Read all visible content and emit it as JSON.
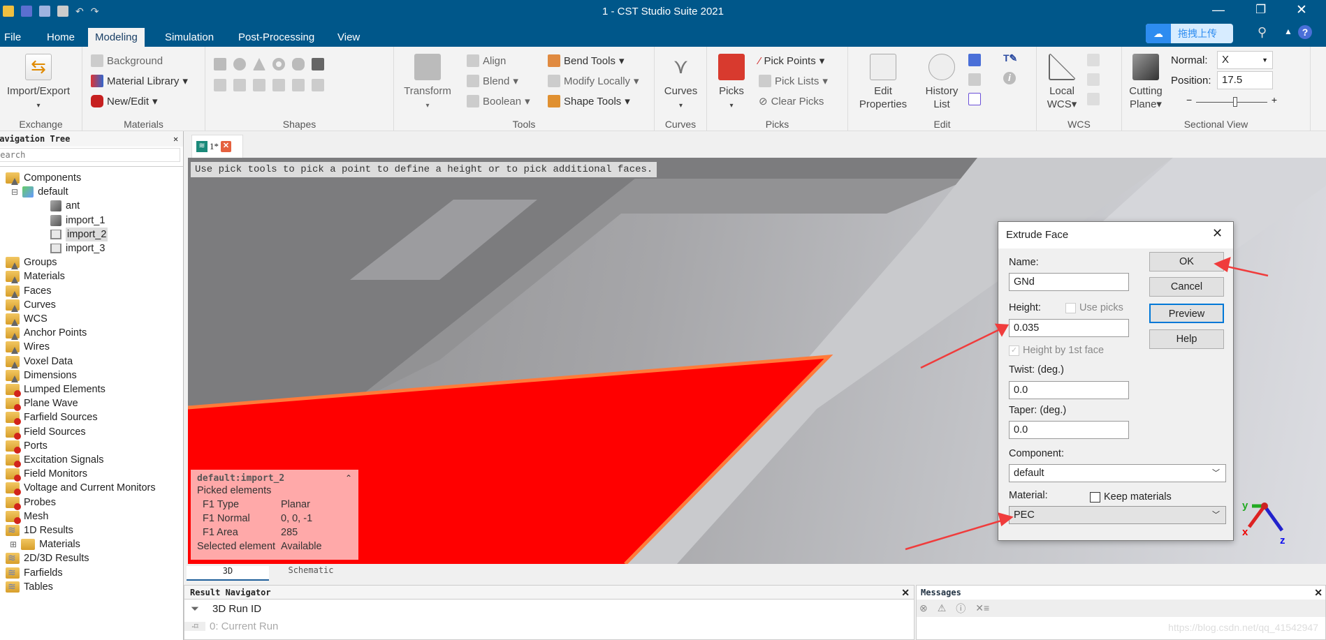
{
  "window": {
    "title": "1 - CST Studio Suite 2021",
    "upload_label": "拖拽上传",
    "search_prefix": "S"
  },
  "menu": [
    "File",
    "Home",
    "Modeling",
    "Simulation",
    "Post-Processing",
    "View"
  ],
  "ribbon": {
    "exchange": {
      "import_export": "Import/Export",
      "label": "Exchange"
    },
    "materials": {
      "background": "Background",
      "material_library": "Material Library",
      "new_edit": "New/Edit",
      "label": "Materials"
    },
    "shapes": {
      "label": "Shapes"
    },
    "tools": {
      "transform": "Transform",
      "align": "Align",
      "blend": "Blend",
      "boolean": "Boolean",
      "bend_tools": "Bend Tools",
      "modify_locally": "Modify Locally",
      "shape_tools": "Shape Tools",
      "label": "Tools"
    },
    "curves": {
      "curves": "Curves",
      "label": "Curves"
    },
    "picks": {
      "picks": "Picks",
      "pick_points": "Pick Points",
      "pick_lists": "Pick Lists",
      "clear_picks": "Clear Picks",
      "label": "Picks"
    },
    "edit": {
      "edit_properties_1": "Edit",
      "edit_properties_2": "Properties",
      "history_1": "History",
      "history_2": "List",
      "label": "Edit"
    },
    "wcs": {
      "local_1": "Local",
      "local_2": "WCS",
      "label": "WCS"
    },
    "sectional": {
      "cutting_1": "Cutting",
      "cutting_2": "Plane",
      "normal_label": "Normal:",
      "normal_value": "X",
      "position_label": "Position:",
      "position_value": "17.5",
      "slider_fraction": 0.55,
      "label": "Sectional View"
    }
  },
  "nav": {
    "title": "Navigation Tree",
    "search_placeholder": "Search",
    "items": [
      "Components",
      "default",
      "ant",
      "import_1",
      "import_2",
      "import_3",
      "Groups",
      "Materials",
      "Faces",
      "Curves",
      "WCS",
      "Anchor Points",
      "Wires",
      "Voxel Data",
      "Dimensions",
      "Lumped Elements",
      "Plane Wave",
      "Farfield Sources",
      "Field Sources",
      "Ports",
      "Excitation Signals",
      "Field Monitors",
      "Voltage and Current Monitors",
      "Probes",
      "Mesh",
      "1D Results",
      "Materials",
      "2D/3D Results",
      "Farfields",
      "Tables"
    ],
    "selected": "import_2"
  },
  "doc_tab": {
    "label": "1*"
  },
  "viewport": {
    "hint": "Use pick tools to pick a point to define a height or to pick additional faces.",
    "highlight_color": "#ff0000",
    "info": {
      "title": "default:import_2",
      "heading": "Picked elements",
      "rows": [
        [
          "F1 Type",
          "Planar"
        ],
        [
          "F1 Normal",
          "0, 0, -1"
        ],
        [
          "F1 Area",
          "285"
        ],
        [
          "Selected element",
          "Available"
        ]
      ]
    },
    "axes": {
      "x": "x",
      "y": "y",
      "z": "z"
    }
  },
  "dialog": {
    "title": "Extrude Face",
    "name_label": "Name:",
    "name_value": "GNd",
    "height_label": "Height:",
    "use_picks": "Use picks",
    "height_value": "0.035",
    "height_by_face": "Height by 1st face",
    "twist_label": "Twist: (deg.)",
    "twist_value": "0.0",
    "taper_label": "Taper: (deg.)",
    "taper_value": "0.0",
    "component_label": "Component:",
    "component_value": "default",
    "material_label": "Material:",
    "keep_materials": "Keep materials",
    "material_value": "PEC",
    "ok": "OK",
    "cancel": "Cancel",
    "preview": "Preview",
    "help": "Help"
  },
  "view_tabs": [
    "3D",
    "Schematic"
  ],
  "result_nav": {
    "title": "Result Navigator",
    "col": "3D Run ID",
    "row": "0: Current Run"
  },
  "messages": {
    "title": "Messages"
  },
  "watermark": "https://blog.csdn.net/qq_41542947"
}
